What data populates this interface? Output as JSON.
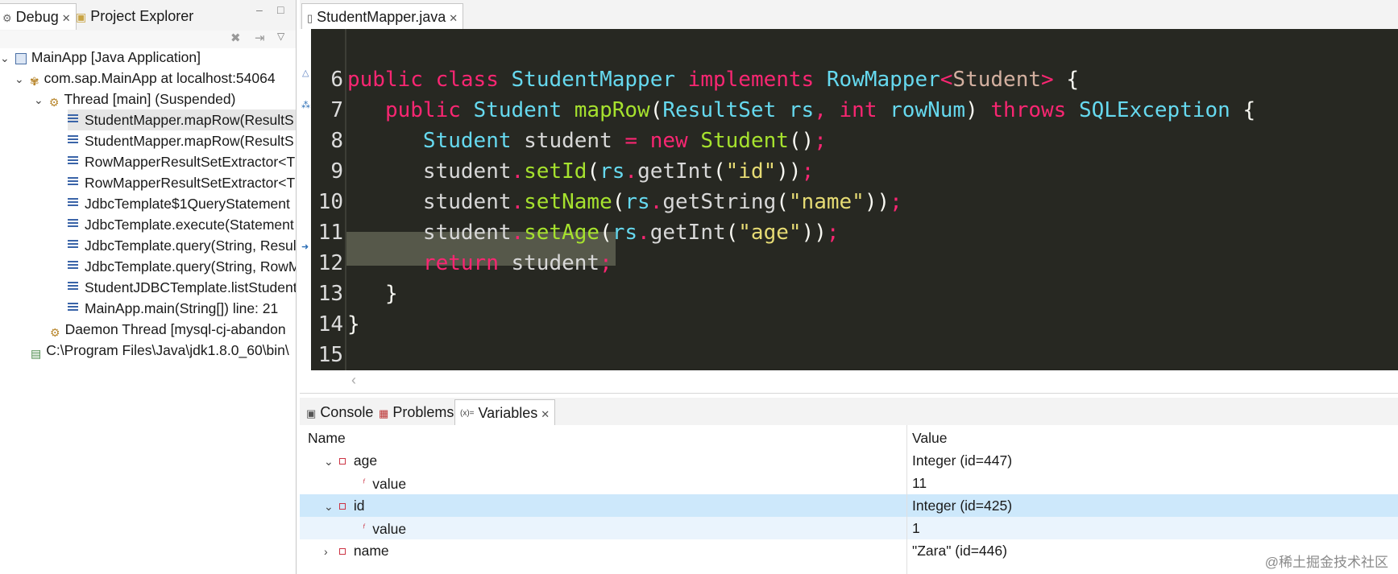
{
  "left": {
    "tabs": [
      {
        "label": "Debug"
      },
      {
        "label": "Project Explorer"
      }
    ],
    "tree": [
      {
        "label": "MainApp [Java Application]",
        "icon": "java-app-icon"
      },
      {
        "label": "com.sap.MainApp at localhost:54064",
        "icon": "debug-target-icon"
      },
      {
        "label": "Thread [main] (Suspended)",
        "icon": "thread-suspended-icon"
      },
      {
        "label": "StudentMapper.mapRow(ResultS"
      },
      {
        "label": "StudentMapper.mapRow(ResultS"
      },
      {
        "label": "RowMapperResultSetExtractor<T"
      },
      {
        "label": "RowMapperResultSetExtractor<T"
      },
      {
        "label": "JdbcTemplate$1QueryStatement"
      },
      {
        "label": "JdbcTemplate.execute(Statement"
      },
      {
        "label": "JdbcTemplate.query(String, Resul"
      },
      {
        "label": "JdbcTemplate.query(String, RowM"
      },
      {
        "label": "StudentJDBCTemplate.listStudent"
      },
      {
        "label": "MainApp.main(String[]) line: 21"
      },
      {
        "label": "Daemon Thread [mysql-cj-abandon",
        "icon": "daemon-thread-icon"
      },
      {
        "label": "C:\\Program Files\\Java\\jdk1.8.0_60\\bin\\",
        "icon": "process-icon"
      }
    ]
  },
  "editor": {
    "tab": "StudentMapper.java",
    "line_numbers": [
      "6",
      "7",
      "8",
      "9",
      "10",
      "11",
      "12",
      "13",
      "14",
      "15"
    ]
  },
  "bottom": {
    "tabs": [
      {
        "label": "Console"
      },
      {
        "label": "Problems"
      },
      {
        "label": "Variables",
        "prefix": "(x)="
      }
    ],
    "columns": {
      "name": "Name",
      "value": "Value"
    },
    "rows": [
      {
        "name": "age",
        "value": "Integer  (id=447)"
      },
      {
        "name": "value",
        "value": "11"
      },
      {
        "name": "id",
        "value": "Integer  (id=425)"
      },
      {
        "name": "value",
        "value": "1"
      },
      {
        "name": "name",
        "value": "\"Zara\" (id=446)"
      }
    ]
  },
  "watermark": "@稀土掘金技术社区",
  "colors": {
    "editor_bg": "#272822",
    "keyword": "#f92672",
    "type": "#66d9ef",
    "method": "#a6e22e",
    "string": "#e6db74",
    "selection": "#cde8fb"
  }
}
